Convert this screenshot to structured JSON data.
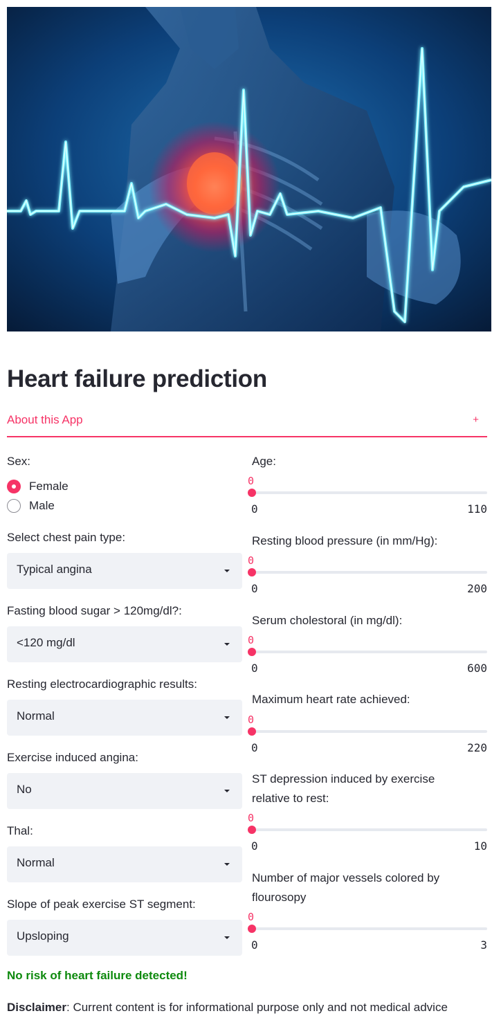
{
  "page_title": "Heart failure prediction",
  "expander": {
    "label": "About this App",
    "icon": "+"
  },
  "sex": {
    "label": "Sex:",
    "options": [
      "Female",
      "Male"
    ],
    "selected": "Female"
  },
  "chest_pain": {
    "label": "Select chest pain type:",
    "value": "Typical angina"
  },
  "fasting_blood_sugar": {
    "label": "Fasting blood sugar > 120mg/dl?:",
    "value": "<120 mg/dl"
  },
  "resting_ecg": {
    "label": "Resting electrocardiographic results:",
    "value": "Normal"
  },
  "exercise_angina": {
    "label": "Exercise induced angina:",
    "value": "No"
  },
  "thal": {
    "label": "Thal:",
    "value": "Normal"
  },
  "slope": {
    "label": "Slope of peak exercise ST segment:",
    "value": "Upsloping"
  },
  "sliders": [
    {
      "label": "Age:",
      "value": "0",
      "min": "0",
      "max": "110"
    },
    {
      "label": "Resting blood pressure (in mm/Hg):",
      "value": "0",
      "min": "0",
      "max": "200"
    },
    {
      "label": "Serum cholestoral (in mg/dl):",
      "value": "0",
      "min": "0",
      "max": "600"
    },
    {
      "label": "Maximum heart rate achieved:",
      "value": "0",
      "min": "0",
      "max": "220"
    },
    {
      "label_line1": "ST depression induced by exercise",
      "label_line2": "relative to rest:",
      "value": "0",
      "min": "0",
      "max": "10"
    },
    {
      "label_line1": "Number of major vessels colored by",
      "label_line2": "flourosopy",
      "value": "0",
      "min": "0",
      "max": "3"
    }
  ],
  "result": "No risk of heart failure detected!",
  "disclaimer": {
    "bold": "Disclaimer",
    "text": ": Current content is for informational purpose only and not medical advice"
  },
  "colors": {
    "accent": "#f63366",
    "success": "#0e8a0e",
    "text": "#262730",
    "select_bg": "#f0f2f6"
  }
}
